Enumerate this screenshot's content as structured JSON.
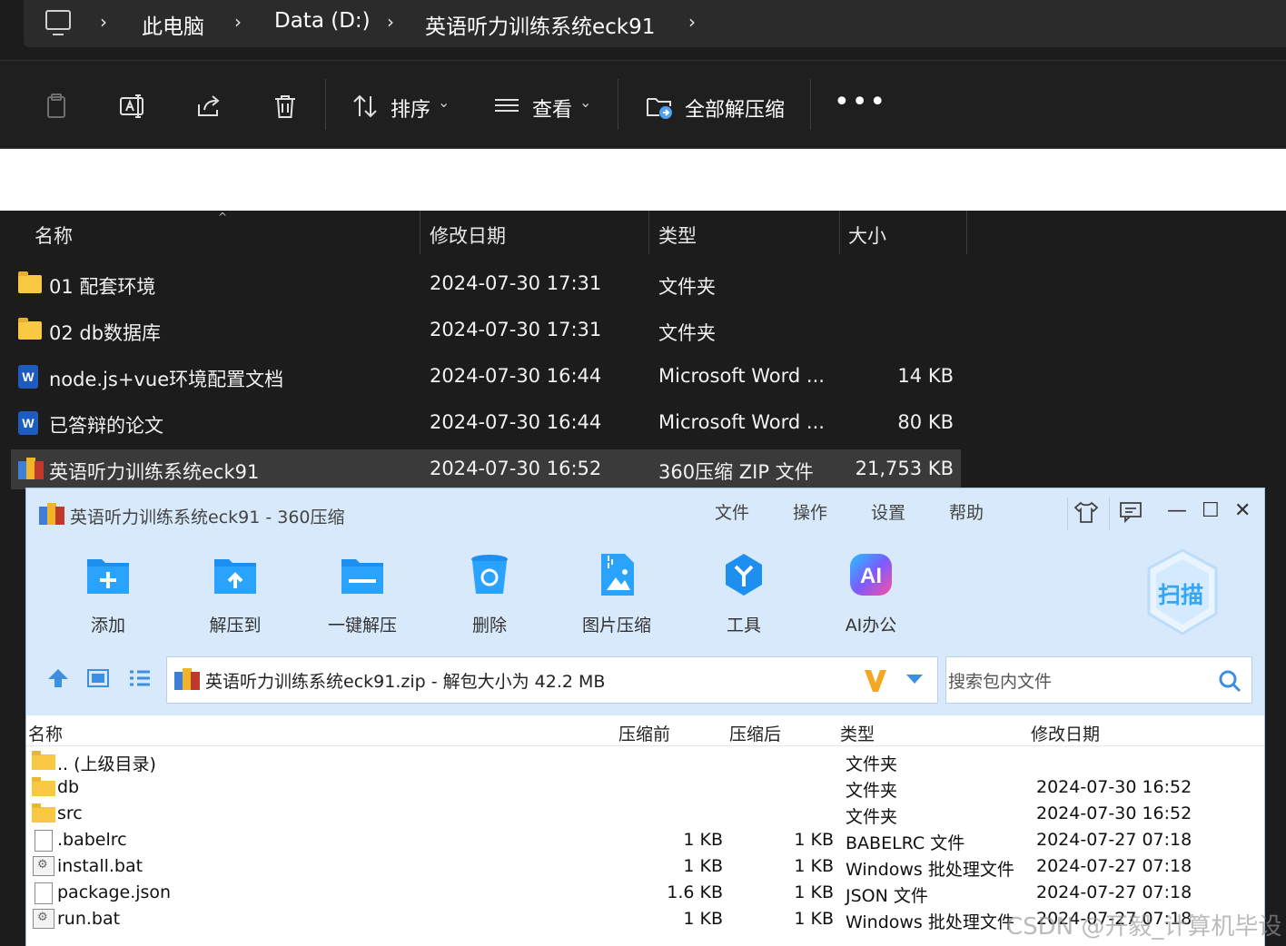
{
  "explorer": {
    "breadcrumb": [
      "此电脑",
      "Data (D:)",
      "英语听力训练系统eck91"
    ],
    "commands": {
      "sort": "排序",
      "view": "查看",
      "extract_all": "全部解压缩"
    },
    "columns": [
      "名称",
      "修改日期",
      "类型",
      "大小"
    ],
    "files": [
      {
        "name": "01 配套环境",
        "date": "2024-07-30 17:31",
        "type": "文件夹",
        "size": ""
      },
      {
        "name": "02 db数据库",
        "date": "2024-07-30 17:31",
        "type": "文件夹",
        "size": ""
      },
      {
        "name": "node.js+vue环境配置文档",
        "date": "2024-07-30 16:44",
        "type": "Microsoft Word ...",
        "size": "14 KB"
      },
      {
        "name": "已答辩的论文",
        "date": "2024-07-30 16:44",
        "type": "Microsoft Word ...",
        "size": "80 KB"
      },
      {
        "name": "英语听力训练系统eck91",
        "date": "2024-07-30 16:52",
        "type": "360压缩 ZIP 文件",
        "size": "21,753 KB"
      }
    ]
  },
  "zip_window": {
    "title": "英语听力训练系统eck91 - 360压缩",
    "menu": [
      "文件",
      "操作",
      "设置",
      "帮助"
    ],
    "tools": [
      "添加",
      "解压到",
      "一键解压",
      "删除",
      "图片压缩",
      "工具",
      "AI办公"
    ],
    "scan_label": "扫描",
    "path": "英语听力训练系统eck91.zip - 解包大小为 42.2 MB",
    "search_placeholder": "搜索包内文件",
    "columns": [
      "名称",
      "压缩前",
      "压缩后",
      "类型",
      "修改日期"
    ],
    "entries": [
      {
        "name": ".. (上级目录)",
        "before": "",
        "after": "",
        "type": "文件夹",
        "date": ""
      },
      {
        "name": "db",
        "before": "",
        "after": "",
        "type": "文件夹",
        "date": "2024-07-30 16:52"
      },
      {
        "name": "src",
        "before": "",
        "after": "",
        "type": "文件夹",
        "date": "2024-07-30 16:52"
      },
      {
        "name": ".babelrc",
        "before": "1 KB",
        "after": "1 KB",
        "type": "BABELRC 文件",
        "date": "2024-07-27 07:18"
      },
      {
        "name": "install.bat",
        "before": "1 KB",
        "after": "1 KB",
        "type": "Windows 批处理文件",
        "date": "2024-07-27 07:18"
      },
      {
        "name": "package.json",
        "before": "1.6 KB",
        "after": "1 KB",
        "type": "JSON 文件",
        "date": "2024-07-27 07:18"
      },
      {
        "name": "run.bat",
        "before": "1 KB",
        "after": "1 KB",
        "type": "Windows 批处理文件",
        "date": "2024-07-27 07:18"
      }
    ]
  },
  "watermark": "CSDN @开毅_计算机毕设"
}
